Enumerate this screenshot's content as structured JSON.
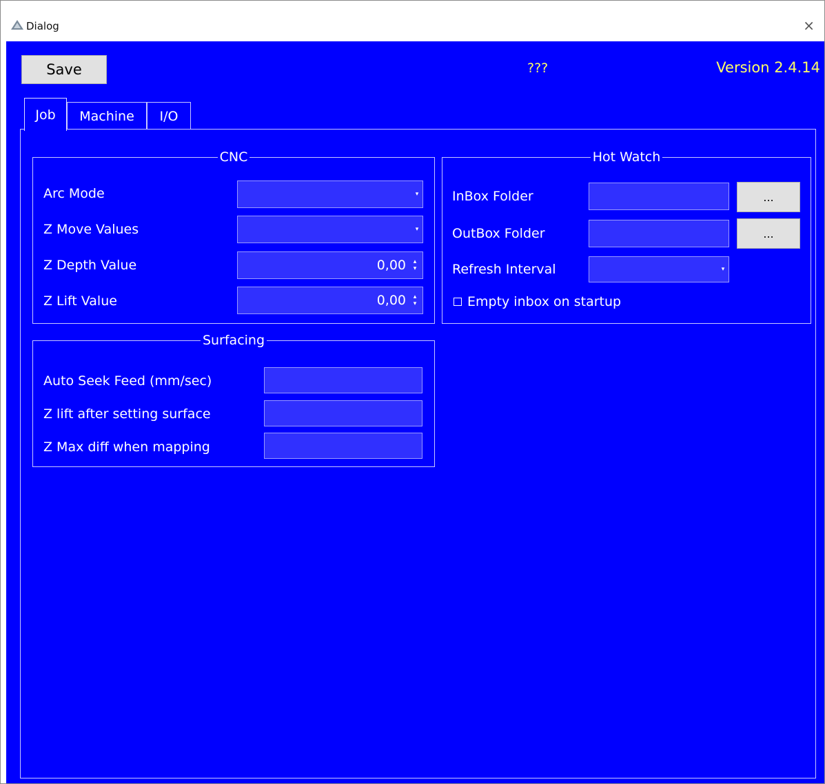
{
  "window": {
    "title": "Dialog",
    "close_glyph": "×"
  },
  "toolbar": {
    "save_label": "Save",
    "status_text": "???",
    "version_text": "Version 2.4.14"
  },
  "tabs": [
    {
      "label": "Job",
      "active": true
    },
    {
      "label": "Machine",
      "active": false
    },
    {
      "label": "I/O",
      "active": false
    }
  ],
  "cnc": {
    "title": "CNC",
    "arc_mode_label": "Arc Mode",
    "arc_mode_value": "",
    "z_move_values_label": "Z Move Values",
    "z_move_values_value": "",
    "z_depth_value_label": "Z Depth Value",
    "z_depth_value": "0,00",
    "z_lift_value_label": "Z Lift Value",
    "z_lift_value": "0,00"
  },
  "hot_watch": {
    "title": "Hot Watch",
    "inbox_label": "InBox Folder",
    "inbox_value": "",
    "inbox_browse": "...",
    "outbox_label": "OutBox Folder",
    "outbox_value": "",
    "outbox_browse": "...",
    "refresh_label": "Refresh Interval",
    "refresh_value": "",
    "empty_inbox_label": "Empty inbox on startup",
    "empty_inbox_checked": false
  },
  "surfacing": {
    "title": "Surfacing",
    "auto_seek_label": "Auto Seek Feed (mm/sec)",
    "auto_seek_value": "",
    "z_lift_surface_label": "Z lift after setting surface",
    "z_lift_surface_value": "",
    "z_max_diff_label": "Z Max diff when mapping",
    "z_max_diff_value": ""
  },
  "colors": {
    "background": "#0000ff",
    "text": "#ffffff",
    "status_text": "#ffff66",
    "button_face": "#e1e1e1"
  },
  "icons": {
    "combo_arrow": "▾",
    "spin_up": "▴",
    "spin_down": "▾"
  }
}
